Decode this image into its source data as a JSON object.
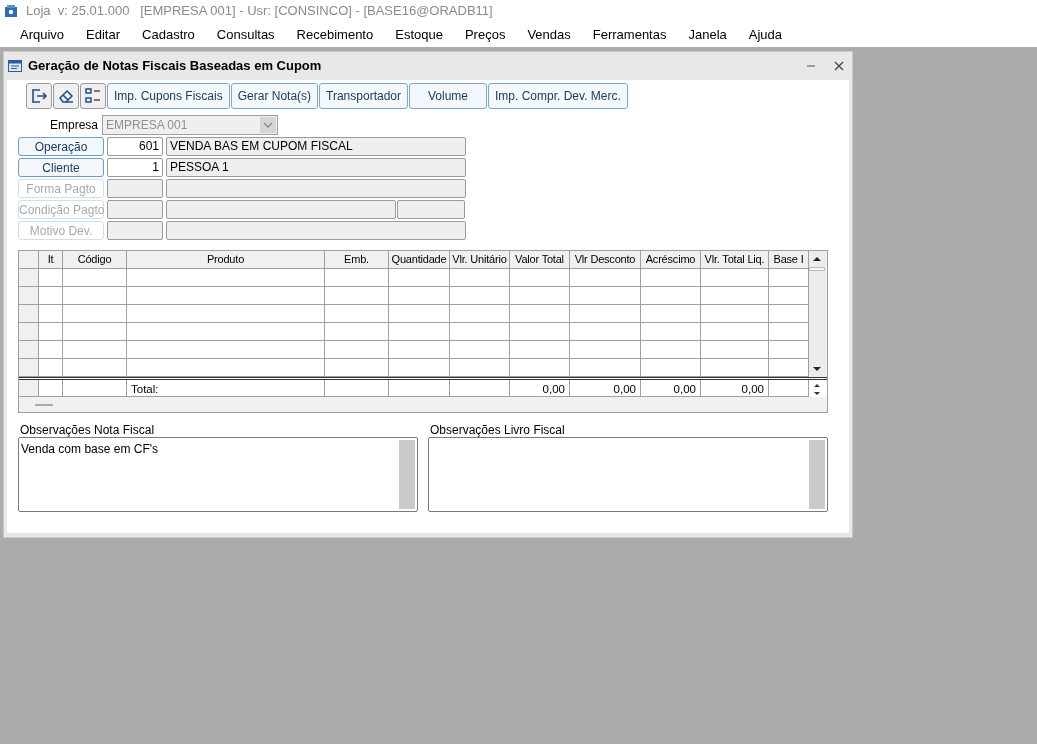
{
  "app_title": "Loja  v: 25.01.000   [EMPRESA 001] - Usr: [CONSINCO] - [BASE16@ORADB11]",
  "menu": [
    "Arquivo",
    "Editar",
    "Cadastro",
    "Consultas",
    "Recebimento",
    "Estoque",
    "Preços",
    "Vendas",
    "Ferramentas",
    "Janela",
    "Ajuda"
  ],
  "window": {
    "title": "Geração de Notas Fiscais Baseadas em Cupom"
  },
  "toolbar": {
    "icon_buttons": [
      {
        "kind": "exit"
      },
      {
        "kind": "eraser"
      },
      {
        "kind": "list"
      }
    ],
    "buttons": [
      "Imp. Cupons Fiscais",
      "Gerar Nota(s)",
      "Transportador",
      "Volume",
      "Imp. Compr. Dev. Merc."
    ]
  },
  "empresa": {
    "label": "Empresa",
    "value": "EMPRESA 001",
    "disabled": true
  },
  "fields": [
    {
      "label": "Operação",
      "disabled": false,
      "code": "601",
      "description": "VENDA BAS EM CUPOM FISCAL"
    },
    {
      "label": "Cliente",
      "disabled": false,
      "code": "1",
      "description": "PESSOA 1"
    },
    {
      "label": "Forma Pagto",
      "disabled": true
    },
    {
      "label": "Condição Pagto",
      "disabled": true,
      "kind": "split"
    },
    {
      "label": "Motivo Dev.",
      "disabled": true
    }
  ],
  "grid": {
    "columns": [
      {
        "label": "It"
      },
      {
        "label": "Código"
      },
      {
        "label": "Produto",
        "total": "Total:"
      },
      {
        "label": "Emb."
      },
      {
        "label": "Quantidade"
      },
      {
        "label": "Vlr. Unitário"
      },
      {
        "label": "Valor Total",
        "total": "0,00"
      },
      {
        "label": "Vlr Desconto",
        "total": "0,00"
      },
      {
        "label": "Acréscimo",
        "total": "0,00"
      },
      {
        "label": "Vlr. Total Liq.",
        "total": "0,00"
      },
      {
        "label": "Base I"
      }
    ]
  },
  "observations": [
    {
      "label": "Observações Nota Fiscal",
      "value": "Venda com base em CF's"
    },
    {
      "label": "Observações Livro Fiscal"
    }
  ]
}
